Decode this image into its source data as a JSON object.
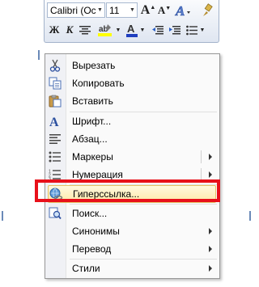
{
  "toolbar": {
    "font_name": "Calibri (Oc",
    "font_size": "11",
    "grow_font_glyph": "A",
    "shrink_font_glyph": "A",
    "bold_glyph": "Ж",
    "italic_glyph": "К"
  },
  "menu": {
    "items": [
      {
        "label": "Вырезать",
        "icon": "scissors-icon"
      },
      {
        "label": "Копировать",
        "icon": "copy-icon"
      },
      {
        "label": "Вставить",
        "icon": "paste-icon"
      },
      {
        "label": "Шрифт...",
        "icon": "font-icon"
      },
      {
        "label": "Абзац...",
        "icon": "paragraph-icon"
      },
      {
        "label": "Маркеры",
        "icon": "bullets-icon",
        "submenu": true
      },
      {
        "label": "Нумерация",
        "icon": "numbering-icon",
        "submenu": true
      },
      {
        "label": "Гиперссылка...",
        "icon": "hyperlink-icon",
        "highlighted": true
      },
      {
        "label": "Поиск...",
        "icon": "search-icon"
      },
      {
        "label": "Синонимы",
        "submenu": true
      },
      {
        "label": "Перевод",
        "submenu": true
      },
      {
        "label": "Стили",
        "submenu": true
      }
    ]
  },
  "colors": {
    "highlight_border": "#e8101a",
    "hover_fill": "#ffe9a8",
    "font_color_bar": "#1f3fbf",
    "highlight_color_bar": "#ffff00"
  }
}
